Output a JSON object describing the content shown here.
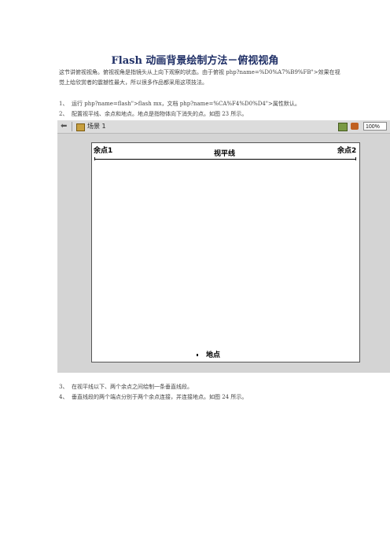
{
  "title": "Flash 动画背景绘制方法－俯视视角",
  "intro": "这节讲俯视视角。俯视视角是指镜头从上向下观察的状态。由于俯视 php?name=%D0%A7%B9%FB\">效果在视觉上给欣赏者的震撼性最大，所以很多作品都采用这项技法。",
  "steps_top": [
    {
      "num": "1、",
      "text": "运行 php?name=flash\">flash mx，文档 php?name=%CA%F4%D0%D4\">属性默认。"
    },
    {
      "num": "2、",
      "text": "配置视平线、余点和地点。地点是指物体向下消失的点。如图 23 所示。"
    }
  ],
  "steps_bottom": [
    {
      "num": "3、",
      "text": "在视平线以下、两个余点之间绘制一条垂直线段。"
    },
    {
      "num": "4、",
      "text": "垂直线段的两个端点分别于两个余点连接，并连接地点。如图 24 所示。"
    }
  ],
  "screenshot": {
    "scene_label": "场景 1",
    "zoom": "100%",
    "left_vanishing_point": "余点1",
    "right_vanishing_point": "余点2",
    "horizon_label": "视平线",
    "ground_point": "地点"
  }
}
